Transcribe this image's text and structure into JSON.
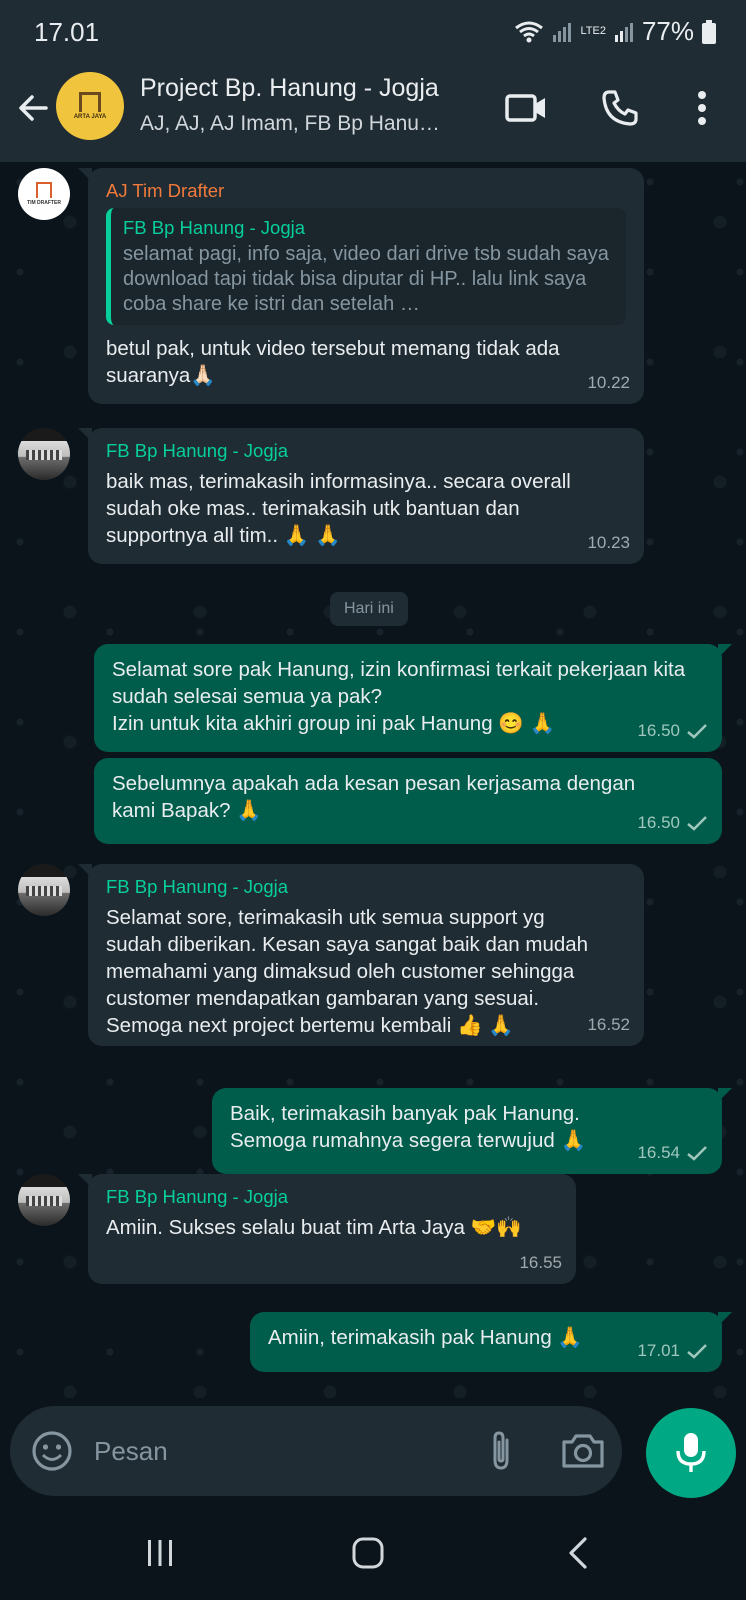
{
  "status_bar": {
    "time": "17.01",
    "network": "LTE2",
    "battery": "77%"
  },
  "header": {
    "title": "Project Bp. Hanung - Jogja",
    "subtitle": "AJ, AJ, AJ Imam, FB Bp Hanu…",
    "avatar_text": "ARTA JAYA"
  },
  "messages": [
    {
      "sender": "AJ Tim Drafter",
      "quote_name": "FB Bp Hanung - Jogja",
      "quote_text": "selamat pagi, info saja, video dari drive tsb sudah saya download tapi tidak bisa diputar di HP.. lalu link saya coba share ke istri dan setelah …",
      "text": "betul pak, untuk video tersebut memang tidak ada suaranya🙏🏻",
      "time": "10.22",
      "avatar_text": "TIM DRAFTER"
    },
    {
      "sender": "FB Bp Hanung - Jogja",
      "text": "baik mas, terimakasih informasinya.. secara overall sudah oke mas.. terimakasih utk bantuan dan supportnya all tim.. 🙏 🙏",
      "time": "10.23"
    },
    {
      "text": "Selamat sore pak Hanung, izin konfirmasi terkait pekerjaan kita sudah selesai semua ya pak?\nIzin untuk kita akhiri group ini pak Hanung 😊 🙏",
      "time": "16.50"
    },
    {
      "text": "Sebelumnya apakah ada kesan pesan kerjasama dengan kami Bapak? 🙏",
      "time": "16.50"
    },
    {
      "sender": "FB Bp Hanung - Jogja",
      "text": "Selamat sore, terimakasih utk semua support yg sudah diberikan. Kesan saya sangat baik dan mudah memahami yang dimaksud oleh customer sehingga customer mendapatkan gambaran yang sesuai. Semoga next project bertemu kembali 👍 🙏",
      "time": "16.52"
    },
    {
      "text": "Baik, terimakasih banyak pak Hanung.\nSemoga rumahnya segera terwujud 🙏",
      "time": "16.54"
    },
    {
      "sender": "FB Bp Hanung - Jogja",
      "text": "Amiin. Sukses selalu buat tim Arta Jaya 🤝🙌",
      "time": "16.55"
    },
    {
      "text": "Amiin, terimakasih pak Hanung 🙏",
      "time": "17.01"
    }
  ],
  "date_chip": "Hari ini",
  "composer": {
    "placeholder": "Pesan"
  },
  "colors": {
    "outgoing": "#005c4b",
    "incoming": "#1f2c34",
    "accent": "#00a884",
    "background": "#0b141a"
  },
  "icons": [
    "back-arrow-icon",
    "video-call-icon",
    "voice-call-icon",
    "more-options-icon",
    "emoji-icon",
    "attach-icon",
    "camera-icon",
    "mic-icon",
    "check-icon"
  ]
}
